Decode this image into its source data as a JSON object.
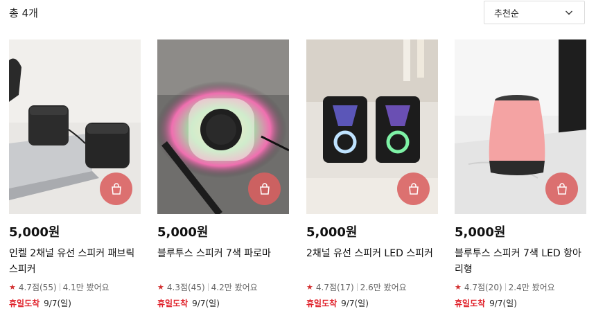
{
  "header": {
    "total": "총 4개",
    "sort_label": "추천순"
  },
  "colors": {
    "accent": "#e0232c",
    "bag_button": "#d96060"
  },
  "products": [
    {
      "price": "5,000원",
      "name": "인켈 2채널 유선 스피커 패브릭 스피커",
      "rating": "4.7점(55)",
      "views": "4.1만 봤어요",
      "delivery_tag": "휴일도착",
      "delivery_date": "9/7(일)"
    },
    {
      "price": "5,000원",
      "name": "블루투스 스피커 7색 파로마",
      "rating": "4.3점(45)",
      "views": "4.2만 봤어요",
      "delivery_tag": "휴일도착",
      "delivery_date": "9/7(일)"
    },
    {
      "price": "5,000원",
      "name": "2채널 유선 스피커 LED 스피커",
      "rating": "4.7점(17)",
      "views": "2.6만 봤어요",
      "delivery_tag": "휴일도착",
      "delivery_date": "9/7(일)"
    },
    {
      "price": "5,000원",
      "name": "블루투스 스피커 7색 LED 항아리형",
      "rating": "4.7점(20)",
      "views": "2.4만 봤어요",
      "delivery_tag": "휴일도착",
      "delivery_date": "9/7(일)"
    }
  ]
}
